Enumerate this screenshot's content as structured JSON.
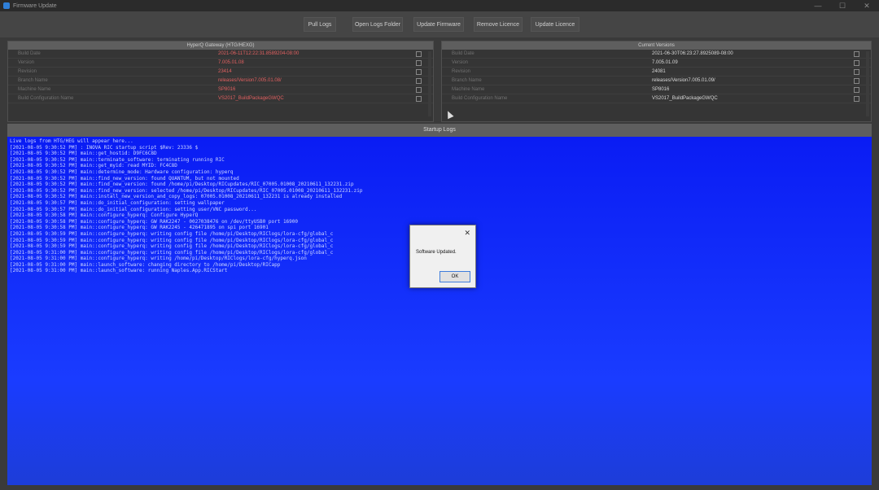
{
  "window": {
    "title": "Firmware Update",
    "controls": [
      "—",
      "☐",
      "✕"
    ]
  },
  "toolbar": {
    "buttons": [
      {
        "label": "Pull Logs"
      },
      {
        "label": "Open Logs Folder"
      },
      {
        "label": "Update Firmware"
      },
      {
        "label": "Remove Licence"
      },
      {
        "label": "Update Licence"
      }
    ]
  },
  "left_panel": {
    "title": "HyperQ Gateway (HTG/HEXG)",
    "rows": [
      {
        "label": "Build Date",
        "value": "2021-06-11T12:22:31.8589204-08:00"
      },
      {
        "label": "Version",
        "value": "7.005.01.08"
      },
      {
        "label": "Revision",
        "value": "23414"
      },
      {
        "label": "Branch Name",
        "value": "releases/Version7.005.01.08/"
      },
      {
        "label": "Machine Name",
        "value": "SP8016"
      },
      {
        "label": "Build Configuration Name",
        "value": "VS2017_BuildPackageGWQC"
      }
    ]
  },
  "right_panel": {
    "title": "Current Versions",
    "rows": [
      {
        "label": "Build Date",
        "value": "2021-06-30T06:23:27.8925089-08:00"
      },
      {
        "label": "Version",
        "value": "7.005.01.09"
      },
      {
        "label": "Revision",
        "value": "24081"
      },
      {
        "label": "Branch Name",
        "value": "releases/Version7.005.01.09/"
      },
      {
        "label": "Machine Name",
        "value": "SP8016"
      },
      {
        "label": "Build Configuration Name",
        "value": "VS2017_BuildPackageGWQC"
      }
    ]
  },
  "logs": {
    "title": "Startup Logs",
    "lines": [
      "Live logs from HTG/HEG will appear here...",
      "[2021-08-05 9:30:52 PM] : INOVA RIC startup script $Rev: 23336 $",
      "[2021-08-05 9:30:52 PM] main::get_hostid: D9FC6C8D",
      "[2021-08-05 9:30:52 PM] main::terminate_software: terminating running RIC",
      "[2021-08-05 9:30:52 PM] main::get_myid: read MYID: FC4C8D",
      "[2021-08-05 9:30:52 PM] main::determine_mode: Hardware configuration: hyperq",
      "[2021-08-05 9:30:52 PM] main::find_new_version: found QUANTUM, but not mounted",
      "[2021-08-05 9:30:52 PM] main::find_new_version: found /home/pi/Desktop/RICupdates/RIC_07005.01008_20210611_132231.zip",
      "[2021-08-05 9:30:52 PM] main::find_new_version: selected /home/pi/Desktop/RICupdates/RIC_07005.01008_20210611_132231.zip",
      "[2021-08-05 9:30:52 PM] main::install_new_version_and_copy_logs: 07005.01008_20210611_132231 is already installed",
      "[2021-08-05 9:30:57 PM] main::do_initial_configuration: setting wallpaper",
      "[2021-08-05 9:30:57 PM] main::do_initial_configuration: setting user/VNC password...",
      "[2021-08-05 9:30:58 PM] main::configure_hyperq: Configure HyperQ",
      "[2021-08-05 9:30:58 PM] main::configure_hyperq: GW RAK2247 - 0027038476 on /dev/ttyUSB0 port 16900",
      "[2021-08-05 9:30:58 PM] main::configure_hyperq: GW RAK2245 - 426471895 on spi port 16901",
      "[2021-08-05 9:30:59 PM] main::configure_hyperq: writing config file /home/pi/Desktop/RIClogs/lora-cfg/global_c",
      "[2021-08-05 9:30:59 PM] main::configure_hyperq: writing config file /home/pi/Desktop/RIClogs/lora-cfg/global_c",
      "[2021-08-05 9:30:59 PM] main::configure_hyperq: writing config file /home/pi/Desktop/RIClogs/lora-cfg/global_c",
      "[2021-08-05 9:31:00 PM] main::configure_hyperq: writing config file /home/pi/Desktop/RIClogs/lora-cfg/global_c",
      "[2021-08-05 9:31:00 PM] main::configure_hyperq: writing /home/pi/Desktop/RIClogs/lora-cfg/hyperq.json",
      "[2021-08-05 9:31:00 PM] main::launch_software: changing directory to /home/pi/Desktop/RICapp",
      "[2021-08-05 9:31:00 PM] main::launch_software: running Naples.App.RICStart"
    ]
  },
  "dialog": {
    "message": "Software Updated.",
    "ok_label": "OK",
    "close_glyph": "✕"
  },
  "colors": {
    "accent": "#2f7fd8",
    "log_background": "#0a1cf4",
    "error_value": "#e06060"
  }
}
